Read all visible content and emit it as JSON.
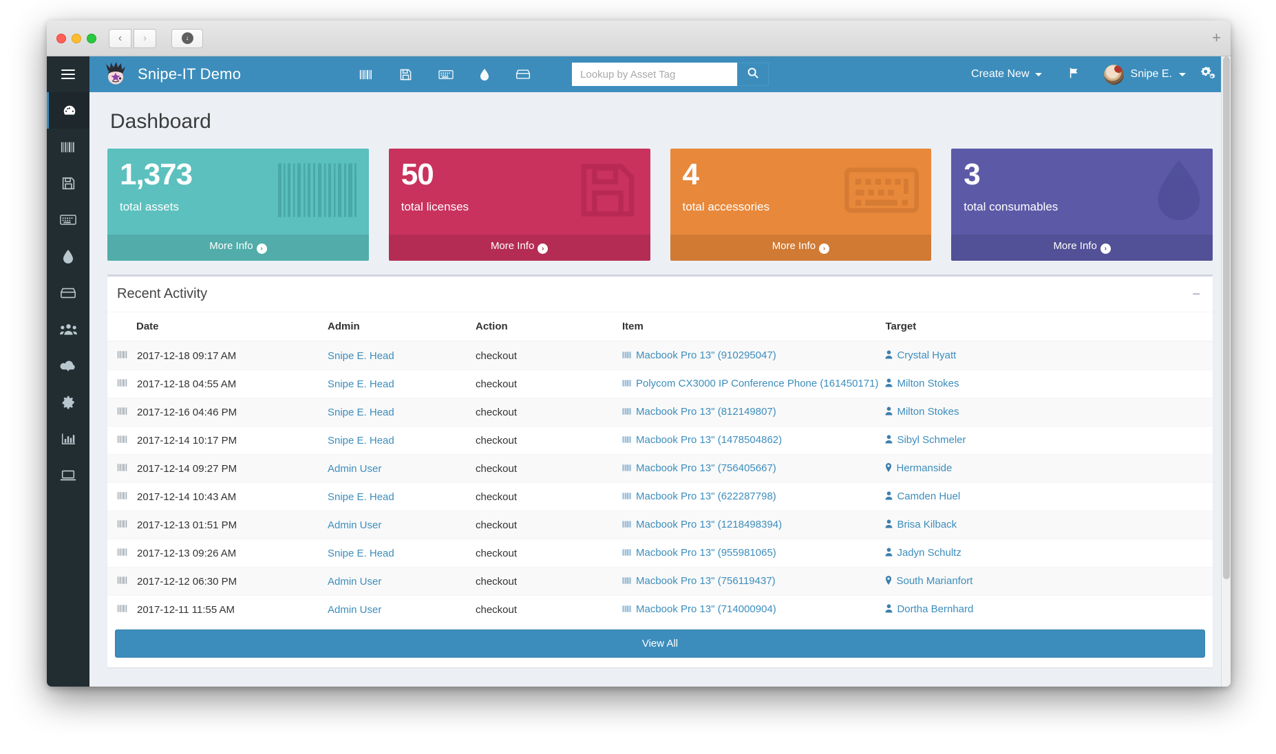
{
  "browser": {
    "back_label": "‹",
    "forward_label": "›",
    "download_label": "↓",
    "new_tab_label": "+"
  },
  "app": {
    "brand_title": "Snipe-IT Demo",
    "page_title": "Dashboard",
    "accent_color": "#3c8dbc",
    "sidebar_color": "#222d32"
  },
  "navbar": {
    "icons": [
      {
        "name": "barcode-icon"
      },
      {
        "name": "floppy-disk-icon"
      },
      {
        "name": "keyboard-icon"
      },
      {
        "name": "droplet-icon"
      },
      {
        "name": "component-icon"
      }
    ],
    "search_placeholder": "Lookup by Asset Tag",
    "search_value": "",
    "search_button_label": "search-icon",
    "create_new_label": "Create New",
    "flag_label": "flag-icon",
    "user_label": "Snipe E.",
    "settings_label": "gears-icon"
  },
  "sidebar": {
    "items": [
      {
        "name": "dashboard",
        "icon": "tachometer-icon",
        "active": true
      },
      {
        "name": "assets",
        "icon": "barcode-icon",
        "active": false
      },
      {
        "name": "licenses",
        "icon": "floppy-disk-icon",
        "active": false
      },
      {
        "name": "accessories",
        "icon": "keyboard-icon",
        "active": false
      },
      {
        "name": "consumables",
        "icon": "droplet-icon",
        "active": false
      },
      {
        "name": "components",
        "icon": "component-icon",
        "active": false
      },
      {
        "name": "people",
        "icon": "users-icon",
        "active": false
      },
      {
        "name": "import",
        "icon": "cloud-download-icon",
        "active": false
      },
      {
        "name": "settings",
        "icon": "gear-icon",
        "active": false
      },
      {
        "name": "reports",
        "icon": "bar-chart-icon",
        "active": false
      },
      {
        "name": "requestable",
        "icon": "laptop-icon",
        "active": false
      }
    ]
  },
  "cards": [
    {
      "value": "1,373",
      "label": "total assets",
      "more_label": "More Info",
      "color": "#5bc0be",
      "icon": "barcode-icon"
    },
    {
      "value": "50",
      "label": "total licenses",
      "more_label": "More Info",
      "color": "#c9325d",
      "icon": "floppy-disk-icon"
    },
    {
      "value": "4",
      "label": "total accessories",
      "more_label": "More Info",
      "color": "#e8883a",
      "icon": "keyboard-icon"
    },
    {
      "value": "3",
      "label": "total consumables",
      "more_label": "More Info",
      "color": "#5c5aa7",
      "icon": "droplet-icon"
    }
  ],
  "activity": {
    "panel_title": "Recent Activity",
    "collapse_label": "−",
    "columns": [
      "Date",
      "Admin",
      "Action",
      "Item",
      "Target"
    ],
    "rows": [
      {
        "date": "2017-12-18 09:17 AM",
        "admin": "Snipe E. Head",
        "action": "checkout",
        "item": "Macbook Pro 13\" (910295047)",
        "target": "Crystal Hyatt",
        "target_type": "user"
      },
      {
        "date": "2017-12-18 04:55 AM",
        "admin": "Snipe E. Head",
        "action": "checkout",
        "item": "Polycom CX3000 IP Conference Phone (161450171)",
        "target": "Milton Stokes",
        "target_type": "user"
      },
      {
        "date": "2017-12-16 04:46 PM",
        "admin": "Snipe E. Head",
        "action": "checkout",
        "item": "Macbook Pro 13\" (812149807)",
        "target": "Milton Stokes",
        "target_type": "user"
      },
      {
        "date": "2017-12-14 10:17 PM",
        "admin": "Snipe E. Head",
        "action": "checkout",
        "item": "Macbook Pro 13\" (1478504862)",
        "target": "Sibyl Schmeler",
        "target_type": "user"
      },
      {
        "date": "2017-12-14 09:27 PM",
        "admin": "Admin User",
        "action": "checkout",
        "item": "Macbook Pro 13\" (756405667)",
        "target": "Hermanside",
        "target_type": "location"
      },
      {
        "date": "2017-12-14 10:43 AM",
        "admin": "Snipe E. Head",
        "action": "checkout",
        "item": "Macbook Pro 13\" (622287798)",
        "target": "Camden Huel",
        "target_type": "user"
      },
      {
        "date": "2017-12-13 01:51 PM",
        "admin": "Admin User",
        "action": "checkout",
        "item": "Macbook Pro 13\" (1218498394)",
        "target": "Brisa Kilback",
        "target_type": "user"
      },
      {
        "date": "2017-12-13 09:26 AM",
        "admin": "Snipe E. Head",
        "action": "checkout",
        "item": "Macbook Pro 13\" (955981065)",
        "target": "Jadyn Schultz",
        "target_type": "user"
      },
      {
        "date": "2017-12-12 06:30 PM",
        "admin": "Admin User",
        "action": "checkout",
        "item": "Macbook Pro 13\" (756119437)",
        "target": "South Marianfort",
        "target_type": "location"
      },
      {
        "date": "2017-12-11 11:55 AM",
        "admin": "Admin User",
        "action": "checkout",
        "item": "Macbook Pro 13\" (714000904)",
        "target": "Dortha Bernhard",
        "target_type": "user"
      }
    ],
    "view_all_label": "View All"
  }
}
